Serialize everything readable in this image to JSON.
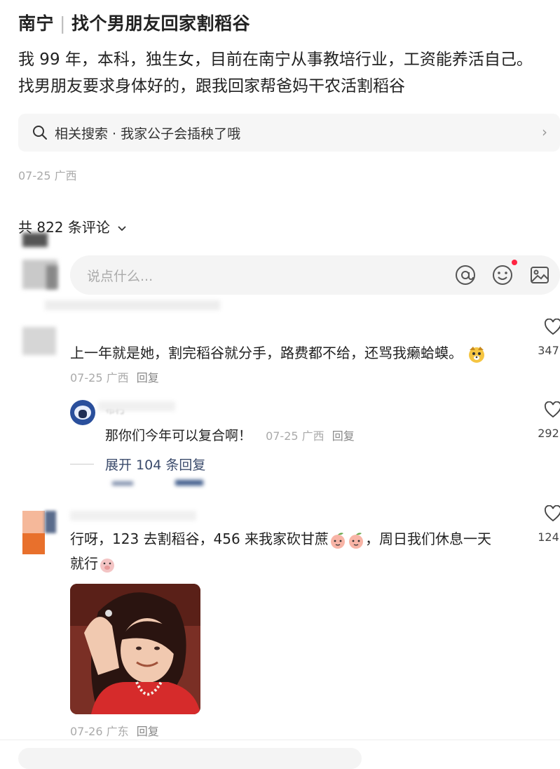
{
  "post": {
    "location": "南宁",
    "title": "找个男朋友回家割稻谷",
    "line1": "我 99 年，本科，独生女，目前在南宁从事教培行业，工资能养活自己。",
    "line2": "找男朋友要求身体好的，跟我回家帮爸妈干农活割稻谷",
    "related": "相关搜索 · 我家公子会插秧了哦",
    "date": "07-25",
    "region": "广西"
  },
  "comments_header": {
    "count_label": "共 822 条评论"
  },
  "input": {
    "placeholder": "说点什么..."
  },
  "comments": [
    {
      "text": "上一年就是她，割完稻谷就分手，路费都不给，还骂我癞蛤蟆。",
      "date": "07-25",
      "region": "广西",
      "reply_label": "回复",
      "likes": "347"
    },
    {
      "username": "布朽",
      "text": "那你们今年可以复合啊！",
      "date": "07-25",
      "region": "广西",
      "reply_label": "回复",
      "likes": "292"
    },
    {
      "text_line1": "行呀，123 去割稻谷，456 来我家砍甘蔗",
      "text_line1_tail": "，周日我们休息一天",
      "text_line2": "就行",
      "date": "07-26",
      "region": "广东",
      "reply_label": "回复",
      "likes": "124"
    }
  ],
  "expand": {
    "label": "展开 104 条回复"
  },
  "colors": {
    "accent_red": "#ff2442",
    "link_blue": "#3a4a6b",
    "muted": "#aaaaaa"
  }
}
